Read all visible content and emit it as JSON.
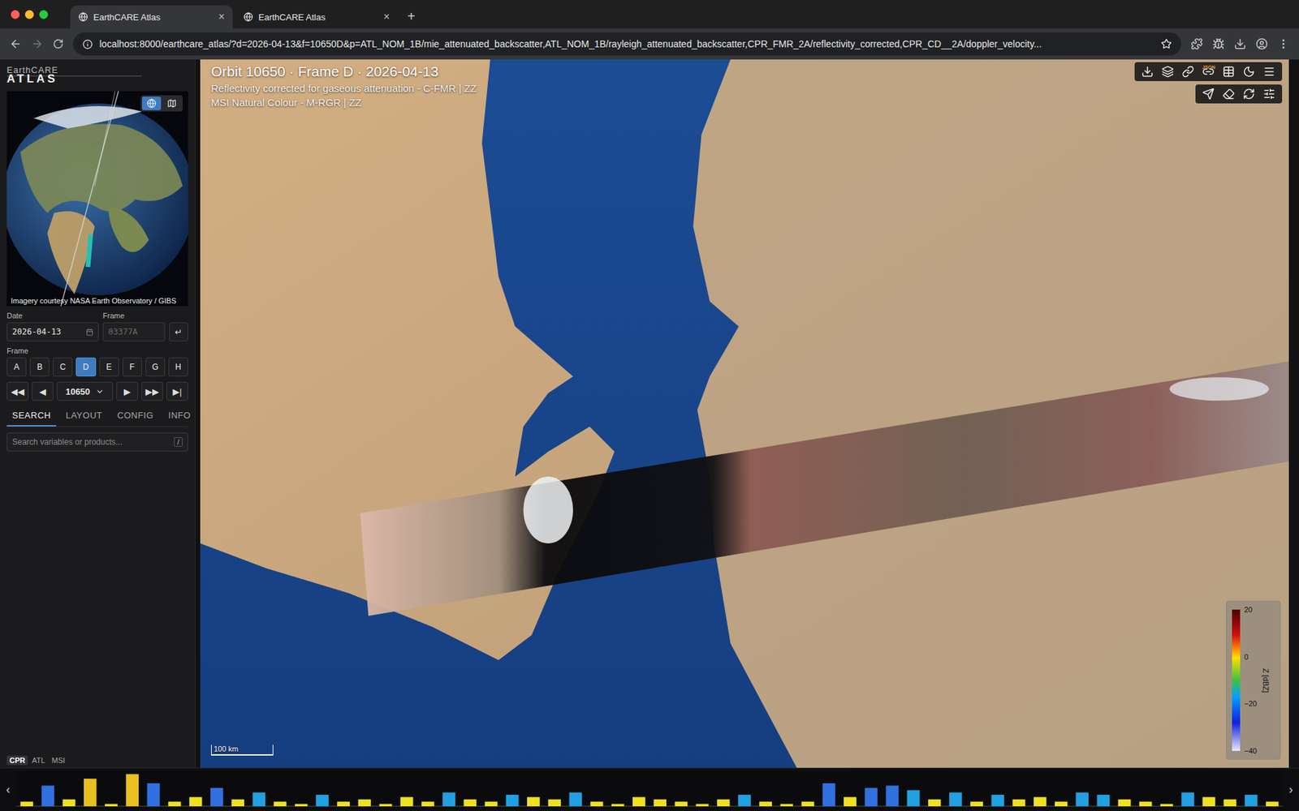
{
  "browser": {
    "tabs": [
      {
        "title": "EarthCARE Atlas",
        "selected": true,
        "close": "×"
      },
      {
        "title": "EarthCARE Atlas",
        "selected": false,
        "close": "×"
      }
    ],
    "new_tab": "+",
    "url": "localhost:8000/earthcare_atlas/?d=2026-04-13&f=10650D&p=ATL_NOM_1B/mie_attenuated_backscatter,ATL_NOM_1B/rayleigh_attenuated_backscatter,CPR_FMR_2A/reflectivity_corrected,CPR_CD__2A/doppler_velocity..."
  },
  "app": {
    "brand_top": "EarthCARE",
    "brand": "ATLAS"
  },
  "globe": {
    "caption": "Imagery courtesy NASA Earth Observatory / GIBS",
    "views": [
      {
        "name": "globe",
        "selected": true
      },
      {
        "name": "map",
        "selected": false
      }
    ]
  },
  "controls": {
    "date_label": "Date",
    "date_value": "2026-04-13",
    "frame_label": "Frame",
    "frame_placeholder": "03377A",
    "go": "↵",
    "frames_label": "Frame",
    "frames": [
      {
        "label": "A",
        "selected": false
      },
      {
        "label": "B",
        "selected": false
      },
      {
        "label": "C",
        "selected": false
      },
      {
        "label": "D",
        "selected": true
      },
      {
        "label": "E",
        "selected": false
      },
      {
        "label": "F",
        "selected": false
      },
      {
        "label": "G",
        "selected": false
      },
      {
        "label": "H",
        "selected": false
      }
    ],
    "nav_before": [
      "◀◀",
      "◀"
    ],
    "orbit": "10650",
    "nav_after": [
      "▶",
      "▶▶",
      "▶|"
    ]
  },
  "sidebar_tabs": [
    {
      "label": "SEARCH",
      "selected": true
    },
    {
      "label": "LAYOUT",
      "selected": false
    },
    {
      "label": "CONFIG",
      "selected": false
    },
    {
      "label": "INFO",
      "selected": false
    }
  ],
  "search": {
    "placeholder": "Search variables or products...",
    "key": "/"
  },
  "map": {
    "title": "Orbit 10650 · Frame D · 2026-04-13",
    "layers": [
      "Reflectivity corrected for gaseous attenuation - C-FMR | ZZ",
      "MSI Natural Colour - M-RGR | ZZ"
    ],
    "scale": "100 km",
    "toolbar_badge": "JSON"
  },
  "colorbar": {
    "ticks": [
      "20",
      "0",
      "−20",
      "−40"
    ],
    "label": "Z [dBZ]"
  },
  "curtain": {
    "tabs": [
      {
        "label": "CPR",
        "selected": true
      },
      {
        "label": "ATL",
        "selected": false
      },
      {
        "label": "MSI",
        "selected": false
      }
    ],
    "prev": "‹",
    "next": "›",
    "heights": [
      2,
      9,
      3,
      12,
      1,
      14,
      10,
      2,
      4,
      8,
      3,
      6,
      2,
      1,
      5,
      2,
      3,
      1,
      4,
      2,
      6,
      3,
      2,
      5,
      4,
      3,
      6,
      2,
      1,
      4,
      3,
      2,
      1,
      3,
      5,
      2,
      1,
      2,
      10,
      4,
      8,
      9,
      7,
      3,
      6,
      2,
      5,
      3,
      4,
      2,
      6,
      5,
      3,
      2,
      1,
      6,
      4,
      3,
      5,
      2
    ]
  }
}
